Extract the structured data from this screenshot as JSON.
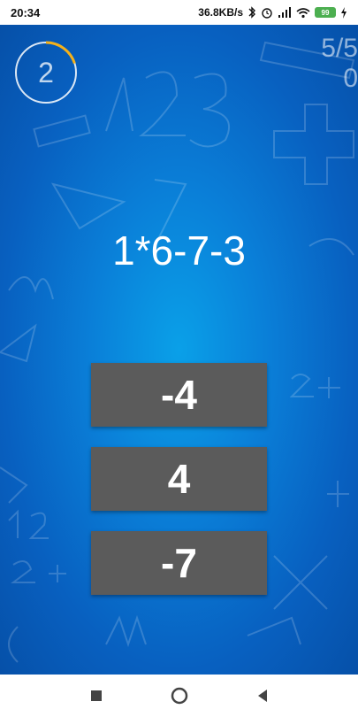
{
  "status_bar": {
    "time": "20:34",
    "network_speed": "36.8KB/s",
    "battery_level": "99"
  },
  "game": {
    "timer_value": "2",
    "timer_progress": 0.2,
    "score_top": "5/5",
    "score_bottom": "0",
    "expression": "1*6-7-3",
    "answers": [
      {
        "label": "-4"
      },
      {
        "label": "4"
      },
      {
        "label": "-7"
      }
    ]
  },
  "colors": {
    "background": "#0a7fd8",
    "button": "#5b5b5b",
    "timer_ring": "#f5b11a"
  },
  "nav_bar": {
    "icons": [
      "recents-square-icon",
      "home-circle-icon",
      "back-triangle-icon"
    ]
  }
}
